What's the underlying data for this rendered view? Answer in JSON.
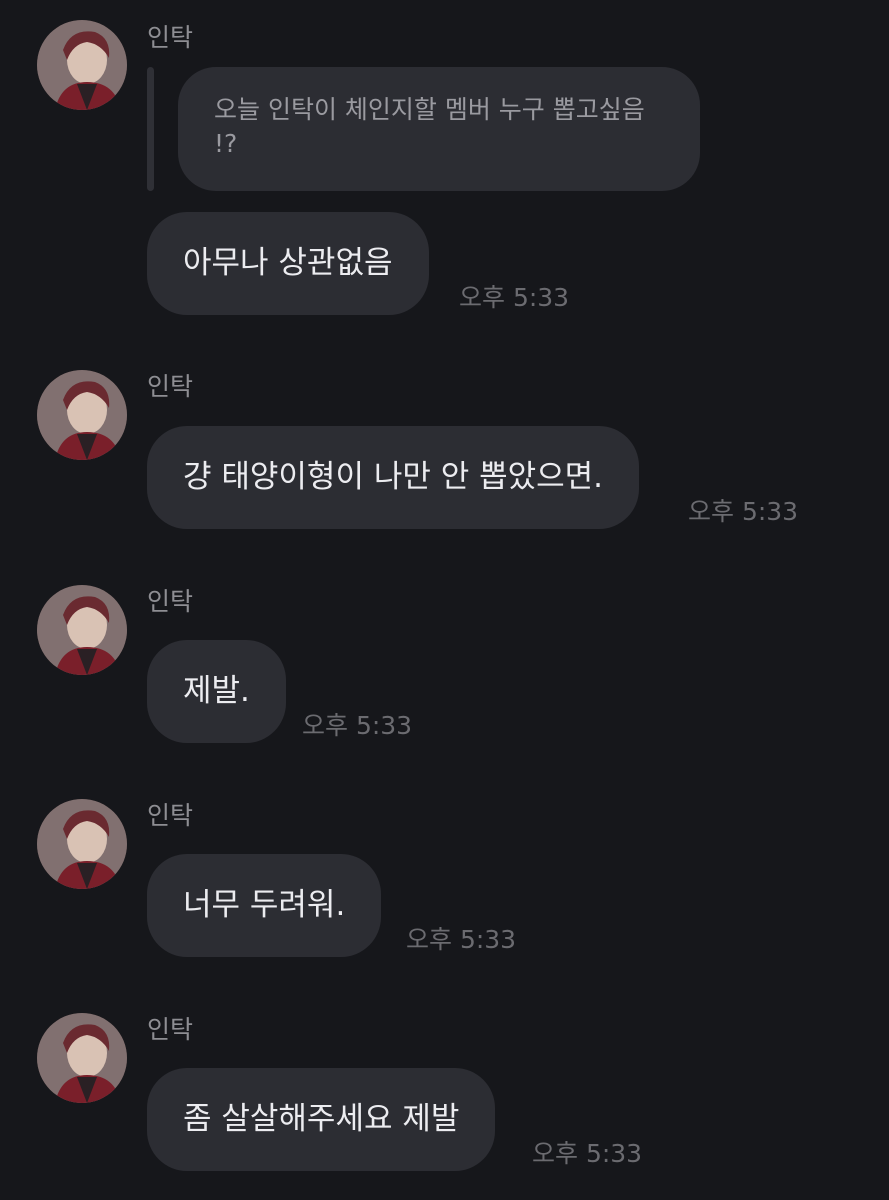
{
  "quoted_message": "오늘 인탁이 체인지할 멤버 누구 뽑고싶음 !?",
  "messages": [
    {
      "sender": "인탁",
      "reply": "아무나 상관없음",
      "time": "오후 5:33"
    },
    {
      "sender": "인탁",
      "reply": "걍 태양이형이 나만 안 뽑았으면.",
      "time": "오후 5:33"
    },
    {
      "sender": "인탁",
      "reply": "제발.",
      "time": "오후 5:33"
    },
    {
      "sender": "인탁",
      "reply": "너무 두려워.",
      "time": "오후 5:33"
    },
    {
      "sender": "인탁",
      "reply": "좀 살살해주세요 제발",
      "time": "오후 5:33"
    }
  ]
}
